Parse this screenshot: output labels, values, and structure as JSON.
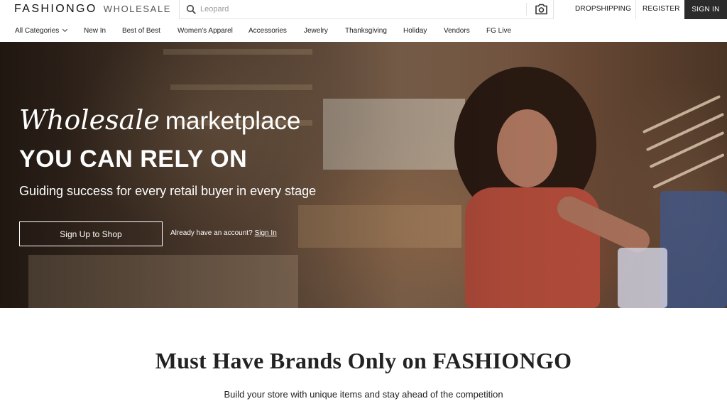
{
  "header": {
    "logo_main": "FASHIONGO",
    "logo_sub": "WHOLESALE",
    "search_placeholder": "Leopard",
    "search_icon": "search-icon",
    "camera_icon": "camera-icon",
    "links": {
      "dropshipping": "DROPSHIPPING",
      "register": "REGISTER",
      "signin": "SIGN IN"
    }
  },
  "nav": {
    "items": [
      "All Categories",
      "New In",
      "Best of Best",
      "Women's Apparel",
      "Accessories",
      "Jewelry",
      "Thanksgiving",
      "Holiday",
      "Vendors",
      "FG Live"
    ]
  },
  "hero": {
    "title_italic": "Wholesale",
    "title_plain": "marketplace",
    "headline": "YOU CAN RELY ON",
    "subtitle": "Guiding success for every retail buyer in every stage",
    "cta_label": "Sign Up to Shop",
    "account_prompt": "Already have an account?",
    "account_link": "Sign In"
  },
  "section": {
    "title": "Must Have Brands Only on FASHIONGO",
    "subtitle": "Build your store with unique items and stay ahead of the competition"
  },
  "colors": {
    "signin_bg": "#2b2b2b",
    "text": "#222222"
  }
}
